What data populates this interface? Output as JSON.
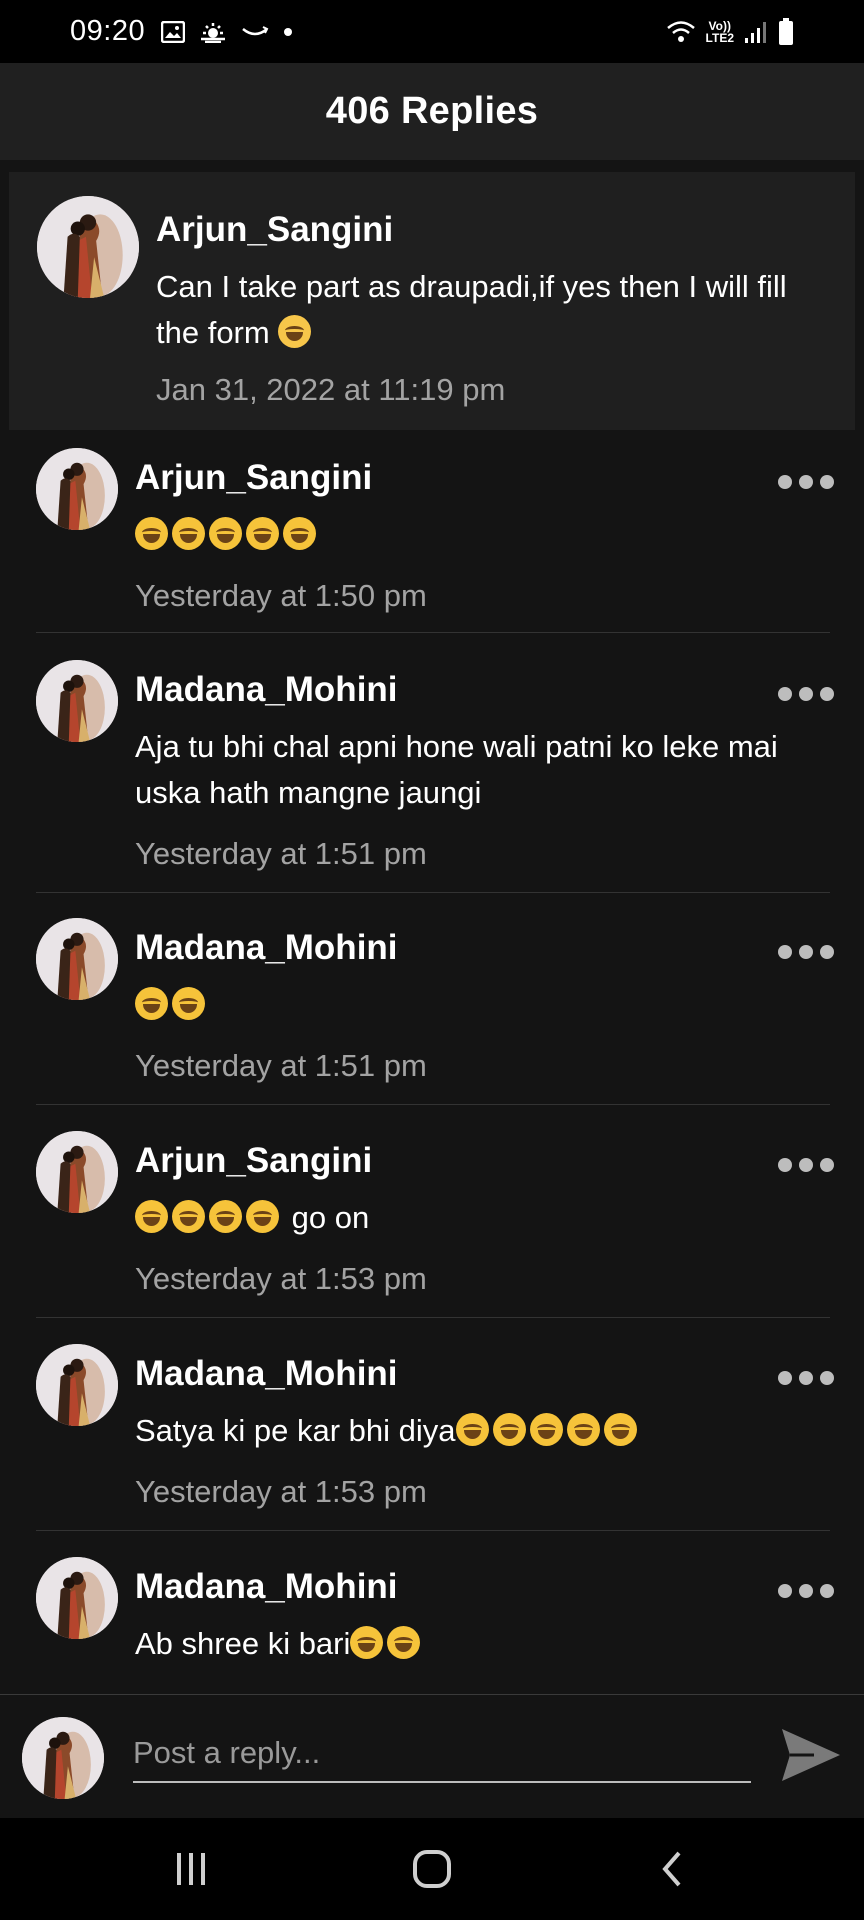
{
  "status_bar": {
    "time": "09:20",
    "left_icons": [
      "image-icon",
      "weather-icon",
      "amazon-icon",
      "dot-icon"
    ],
    "network_label_top": "Vo))",
    "network_label_bottom": "LTE2",
    "right_icons": [
      "wifi-icon",
      "signal-icon",
      "battery-icon"
    ]
  },
  "header": {
    "title": "406 Replies"
  },
  "original_post": {
    "username": "Arjun_Sangini",
    "text": "Can I take part as draupadi,if yes then I will fill the form",
    "emoji_count": 1,
    "timestamp": "Jan 31, 2022 at 11:19 pm"
  },
  "replies": [
    {
      "username": "Arjun_Sangini",
      "text": "",
      "emoji_count": 5,
      "timestamp": "Yesterday at 1:50 pm"
    },
    {
      "username": "Madana_Mohini",
      "text": "Aja tu bhi chal apni hone wali patni ko leke mai uska hath mangne jaungi",
      "emoji_count": 0,
      "timestamp": "Yesterday at 1:51 pm"
    },
    {
      "username": "Madana_Mohini",
      "text": "",
      "emoji_count": 2,
      "timestamp": "Yesterday at 1:51 pm"
    },
    {
      "username": "Arjun_Sangini",
      "text": "go on",
      "emoji_count": 4,
      "emoji_position": "before",
      "timestamp": "Yesterday at 1:53 pm"
    },
    {
      "username": "Madana_Mohini",
      "text": "Satya ki pe kar bhi diya",
      "emoji_count": 5,
      "timestamp": "Yesterday at 1:53 pm"
    },
    {
      "username": "Madana_Mohini",
      "text": "Ab shree ki bari",
      "emoji_count": 2,
      "timestamp": ""
    }
  ],
  "composer": {
    "placeholder": "Post a reply..."
  },
  "nav_bar": {
    "icons": [
      "recents-icon",
      "home-icon",
      "back-icon"
    ]
  },
  "colors": {
    "background": "#141414",
    "header": "#202020",
    "op_background": "#1f1f1f",
    "muted_text": "#a3a3a3",
    "emoji": "#f6c33a"
  }
}
